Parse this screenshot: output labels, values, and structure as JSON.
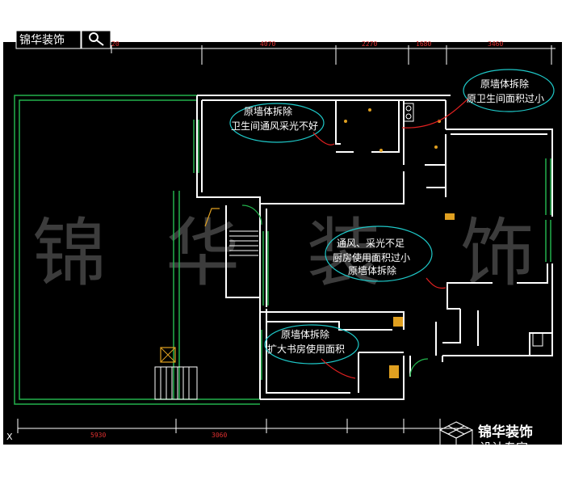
{
  "logo_top": "锦华装饰",
  "watermark": [
    "锦",
    "华",
    "装",
    "饰"
  ],
  "dimensions_top": [
    "20",
    "4070",
    "2270",
    "1680",
    "3460"
  ],
  "dimensions_bottom": [
    "5930",
    "3060"
  ],
  "annotations": {
    "bathroom_right": [
      "原墙体拆除",
      "原卫生间面积过小"
    ],
    "bathroom_left": [
      "原墙体拆除",
      "卫生间通风采光不好"
    ],
    "kitchen": [
      "通风、采光不足",
      "厨房使用面积过小",
      "原墙体拆除"
    ],
    "study": [
      "原墙体拆除",
      "扩大书房使用面积"
    ]
  },
  "brand": {
    "name": "锦华装饰",
    "sub": "设计专家"
  },
  "corner_mark": "X",
  "colors": {
    "background": "#000000",
    "wall": "#ffffff",
    "window": "#22b14c",
    "ellipse": "#1ec8c8",
    "leader": "#e02020",
    "dimension": "#e03030",
    "fixture": "#e0a020"
  }
}
